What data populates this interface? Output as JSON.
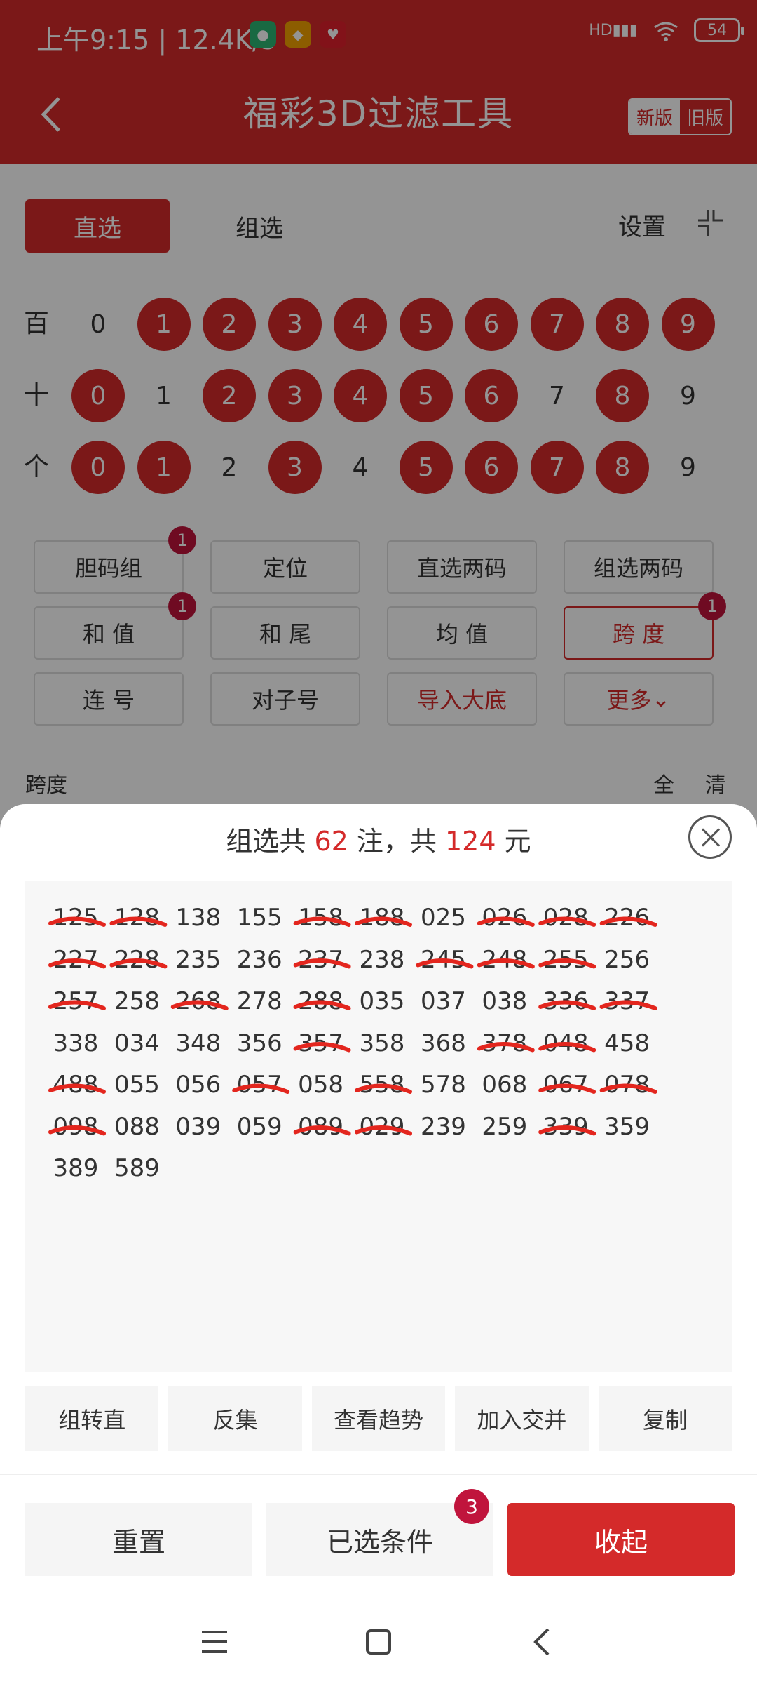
{
  "status": {
    "time": "上午9:15 | 12.4K/s",
    "battery": "54",
    "net": "HD"
  },
  "header": {
    "title": "福彩3D过滤工具",
    "new_label": "新版",
    "old_label": "旧版"
  },
  "tabs": {
    "direct": "直选",
    "group": "组选",
    "settings": "设置"
  },
  "digit_rows": [
    {
      "label": "百",
      "balls": [
        {
          "n": "0",
          "on": false
        },
        {
          "n": "1",
          "on": true
        },
        {
          "n": "2",
          "on": true
        },
        {
          "n": "3",
          "on": true
        },
        {
          "n": "4",
          "on": true
        },
        {
          "n": "5",
          "on": true
        },
        {
          "n": "6",
          "on": true
        },
        {
          "n": "7",
          "on": true
        },
        {
          "n": "8",
          "on": true
        },
        {
          "n": "9",
          "on": true
        }
      ]
    },
    {
      "label": "十",
      "balls": [
        {
          "n": "0",
          "on": true
        },
        {
          "n": "1",
          "on": false
        },
        {
          "n": "2",
          "on": true
        },
        {
          "n": "3",
          "on": true
        },
        {
          "n": "4",
          "on": true
        },
        {
          "n": "5",
          "on": true
        },
        {
          "n": "6",
          "on": true
        },
        {
          "n": "7",
          "on": false
        },
        {
          "n": "8",
          "on": true
        },
        {
          "n": "9",
          "on": false
        }
      ]
    },
    {
      "label": "个",
      "balls": [
        {
          "n": "0",
          "on": true
        },
        {
          "n": "1",
          "on": true
        },
        {
          "n": "2",
          "on": false
        },
        {
          "n": "3",
          "on": true
        },
        {
          "n": "4",
          "on": false
        },
        {
          "n": "5",
          "on": true
        },
        {
          "n": "6",
          "on": true
        },
        {
          "n": "7",
          "on": true
        },
        {
          "n": "8",
          "on": true
        },
        {
          "n": "9",
          "on": false
        }
      ]
    }
  ],
  "filters": [
    {
      "label": "胆码组",
      "badge": "1",
      "state": "normal"
    },
    {
      "label": "定位",
      "badge": "",
      "state": "normal"
    },
    {
      "label": "直选两码",
      "badge": "",
      "state": "normal"
    },
    {
      "label": "组选两码",
      "badge": "",
      "state": "normal"
    },
    {
      "label": "和 值",
      "badge": "1",
      "state": "normal"
    },
    {
      "label": "和 尾",
      "badge": "",
      "state": "normal"
    },
    {
      "label": "均 值",
      "badge": "",
      "state": "normal"
    },
    {
      "label": "跨 度",
      "badge": "1",
      "state": "active"
    },
    {
      "label": "连 号",
      "badge": "",
      "state": "normal"
    },
    {
      "label": "对子号",
      "badge": "",
      "state": "normal"
    },
    {
      "label": "导入大底",
      "badge": "",
      "state": "red"
    },
    {
      "label": "更多",
      "badge": "",
      "state": "red"
    }
  ],
  "span_section": {
    "label": "跨度",
    "all": "全",
    "clear": "清"
  },
  "sheet": {
    "title_prefix": "组选共 ",
    "count": "62",
    "title_mid": " 注，共 ",
    "amount": "124",
    "title_suffix": " 元",
    "numbers": [
      "125",
      "128",
      "138",
      "155",
      "158",
      "188",
      "025",
      "026",
      "028",
      "226",
      "227",
      "228",
      "235",
      "236",
      "237",
      "238",
      "245",
      "248",
      "255",
      "256",
      "257",
      "258",
      "268",
      "278",
      "288",
      "035",
      "037",
      "038",
      "336",
      "337",
      "338",
      "034",
      "348",
      "356",
      "357",
      "358",
      "368",
      "378",
      "048",
      "458",
      "488",
      "055",
      "056",
      "057",
      "058",
      "558",
      "578",
      "068",
      "067",
      "078",
      "098",
      "088",
      "039",
      "059",
      "089",
      "029",
      "239",
      "259",
      "339",
      "359",
      "389",
      "589"
    ],
    "crossed": [
      0,
      1,
      4,
      5,
      7,
      8,
      9,
      10,
      11,
      14,
      16,
      17,
      18,
      20,
      22,
      24,
      28,
      29,
      34,
      37,
      38,
      40,
      43,
      45,
      48,
      49,
      50,
      54,
      55,
      58
    ],
    "actions": [
      "组转直",
      "反集",
      "查看趋势",
      "加入交并",
      "复制"
    ],
    "reset": "重置",
    "conditions": "已选条件",
    "conditions_badge": "3",
    "fold": "收起"
  },
  "colors": {
    "brand": "#d42a2a",
    "badge": "#c0143c"
  }
}
